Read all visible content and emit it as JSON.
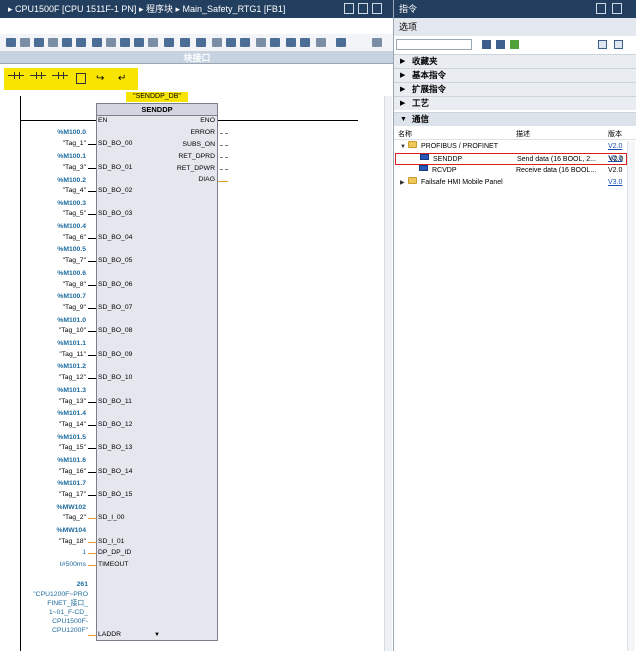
{
  "editor": {
    "title_path": [
      "CPU1500F [CPU 1511F-1 PN]",
      "程序块",
      "Main_Safety_RTG1 [FB1]"
    ],
    "block_interface_label": "块接口",
    "instance_db": "\"SENDDP_DB\"",
    "block_name": "SENDDP",
    "en_label": "EN",
    "eno_label": "ENO",
    "inputs": [
      {
        "pin": "SD_BO_00",
        "addr": "%M100.0",
        "tag": "\"Tag_1\""
      },
      {
        "pin": "SD_BO_01",
        "addr": "%M100.1",
        "tag": "\"Tag_3\""
      },
      {
        "pin": "SD_BO_02",
        "addr": "%M100.2",
        "tag": "\"Tag_4\""
      },
      {
        "pin": "SD_BO_03",
        "addr": "%M100.3",
        "tag": "\"Tag_5\""
      },
      {
        "pin": "SD_BO_04",
        "addr": "%M100.4",
        "tag": "\"Tag_6\""
      },
      {
        "pin": "SD_BO_05",
        "addr": "%M100.5",
        "tag": "\"Tag_7\""
      },
      {
        "pin": "SD_BO_06",
        "addr": "%M100.6",
        "tag": "\"Tag_8\""
      },
      {
        "pin": "SD_BO_07",
        "addr": "%M100.7",
        "tag": "\"Tag_9\""
      },
      {
        "pin": "SD_BO_08",
        "addr": "%M101.0",
        "tag": "\"Tag_10\""
      },
      {
        "pin": "SD_BO_09",
        "addr": "%M101.1",
        "tag": "\"Tag_11\""
      },
      {
        "pin": "SD_BO_10",
        "addr": "%M101.2",
        "tag": "\"Tag_12\""
      },
      {
        "pin": "SD_BO_11",
        "addr": "%M101.3",
        "tag": "\"Tag_13\""
      },
      {
        "pin": "SD_BO_12",
        "addr": "%M101.4",
        "tag": "\"Tag_14\""
      },
      {
        "pin": "SD_BO_13",
        "addr": "%M101.5",
        "tag": "\"Tag_15\""
      },
      {
        "pin": "SD_BO_14",
        "addr": "%M101.6",
        "tag": "\"Tag_16\""
      },
      {
        "pin": "SD_BO_15",
        "addr": "%M101.7",
        "tag": "\"Tag_17\""
      },
      {
        "pin": "SD_I_00",
        "addr": "%MW102",
        "tag": "\"Tag_2\""
      },
      {
        "pin": "SD_I_01",
        "addr": "%MW104",
        "tag": "\"Tag_18\""
      }
    ],
    "dp_dp_id": {
      "pin": "DP_DP_ID",
      "value": "1"
    },
    "timeout": {
      "pin": "TIMEOUT",
      "value": "t#500ms"
    },
    "laddr": {
      "pin": "LADDR",
      "num": "261",
      "lines": [
        "\"CPU1200F~PRO",
        "FINET_接口_",
        "1~01_F-CD_",
        "CPU1500F-",
        "CPU1200F\""
      ]
    },
    "outputs": [
      "ERROR",
      "SUBS_ON",
      "RET_DPRD",
      "RET_DPWR",
      "DIAG"
    ]
  },
  "instructions": {
    "title": "指令",
    "options": "选项",
    "sections": [
      {
        "label": "收藏夹",
        "open": false
      },
      {
        "label": "基本指令",
        "open": false
      },
      {
        "label": "扩展指令",
        "open": false
      },
      {
        "label": "工艺",
        "open": false
      },
      {
        "label": "通信",
        "open": true
      }
    ],
    "columns": {
      "name": "名称",
      "desc": "描述",
      "version": "版本"
    },
    "rows": [
      {
        "name": "",
        "desc": "",
        "version": "V2.0"
      },
      {
        "name": "PROFIBUS / PROFINET",
        "desc": "",
        "version": "V2.0"
      },
      {
        "name": "SENDDP",
        "desc": "Send data (16 BOOL, 2...",
        "version": "V2.0"
      },
      {
        "name": "RCVDP",
        "desc": "Receive data (16 BOOL...",
        "version": "V2.0"
      },
      {
        "name": "Failsafe HMI Mobile Panel",
        "desc": "",
        "version": "V3.0"
      }
    ]
  }
}
